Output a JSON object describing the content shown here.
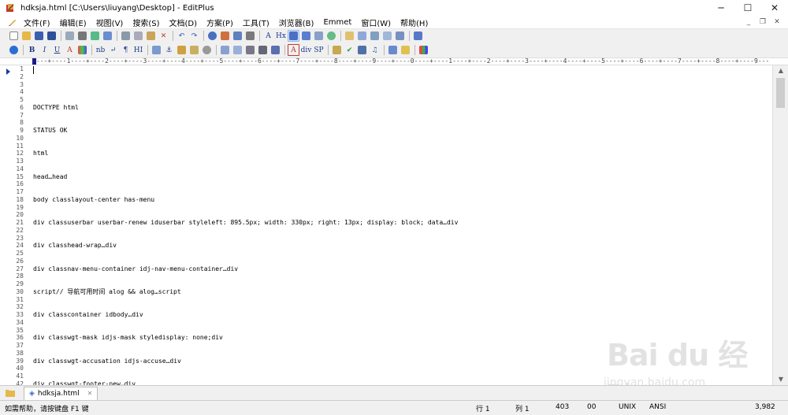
{
  "window": {
    "title": "hdksja.html [C:\\Users\\liuyang\\Desktop] - EditPlus",
    "min_glyph": "─",
    "max_glyph": "☐",
    "close_glyph": "✕"
  },
  "menu": {
    "items": [
      "文件(F)",
      "编辑(E)",
      "视图(V)",
      "搜索(S)",
      "文档(D)",
      "方案(P)",
      "工具(T)",
      "浏览器(B)",
      "Emmet",
      "窗口(W)",
      "帮助(H)"
    ],
    "mdi_min": "_",
    "mdi_restore": "❐",
    "mdi_close": "✕"
  },
  "toolbar2_labels": {
    "bold": "B",
    "italic": "I",
    "underline": "U",
    "font_color": "A",
    "nbsp": "nb",
    "br": "↵",
    "para": "¶",
    "heading": "HI",
    "div": "div",
    "sp": "SP",
    "text_a": "A"
  },
  "toolbar1_labels": {
    "a_plus": "A",
    "hx": "Hx"
  },
  "ruler": {
    "text": "----+----1----+----2----+----3----+----4----+----5----+----6----+----7----+----8----+----9----+----0----+----1----+----2----+----3----+----4----+----5----+----6----+----7----+----8----+----9---"
  },
  "editor": {
    "line_numbers": [
      "1",
      "2",
      "3",
      "4",
      "5",
      "6",
      "7",
      "8",
      "9",
      "10",
      "11",
      "12",
      "13",
      "14",
      "15",
      "16",
      "17",
      "18",
      "19",
      "20",
      "21",
      "22",
      "23",
      "24",
      "25",
      "26",
      "27",
      "28",
      "29",
      "30",
      "31",
      "32",
      "33",
      "34",
      "35",
      "36",
      "37",
      "38",
      "39",
      "40",
      "41",
      "42"
    ],
    "lines": [
      "",
      "",
      "",
      "",
      "",
      "DOCTYPE html",
      "",
      "",
      "STATUS OK",
      "",
      "",
      "html",
      "",
      "",
      "head…head",
      "",
      "",
      "body classlayout-center has-menu",
      "",
      "",
      "div classuserbar userbar-renew iduserbar styleleft: 895.5px; width: 330px; right: 13px; display: block; data…div",
      "",
      "",
      "div classhead-wrap…div",
      "",
      "",
      "div classnav-menu-container idj-nav-menu-container…div",
      "",
      "",
      "script// 导航可用时间 alog && alog…script",
      "",
      "",
      "div classcontainer idbody…div",
      "",
      "",
      "div classwgt-mask idjs-mask styledisplay: none;div",
      "",
      "",
      "div classwgt-accusation idjs-accuse…div",
      "",
      "",
      "div classwgt-footer-new…div"
    ]
  },
  "scrollbar": {
    "up": "▲",
    "down": "▼"
  },
  "tabs": {
    "file_tab": "hdksja.html",
    "close": "✕"
  },
  "status": {
    "help": "如需帮助，请按键盘 F1 键",
    "row": "行 1",
    "col": "列 1",
    "num1": "403",
    "num2": "00",
    "line_ending": "UNIX",
    "encoding": "ANSI",
    "size": "3,982"
  },
  "watermark": {
    "brand": "Bai du 经验",
    "url": "jingyan.baidu.com"
  },
  "colors": {
    "accent": "#1a3a9a",
    "editor_bg": "#ffffff",
    "chrome_bg": "#f0f0f0"
  }
}
